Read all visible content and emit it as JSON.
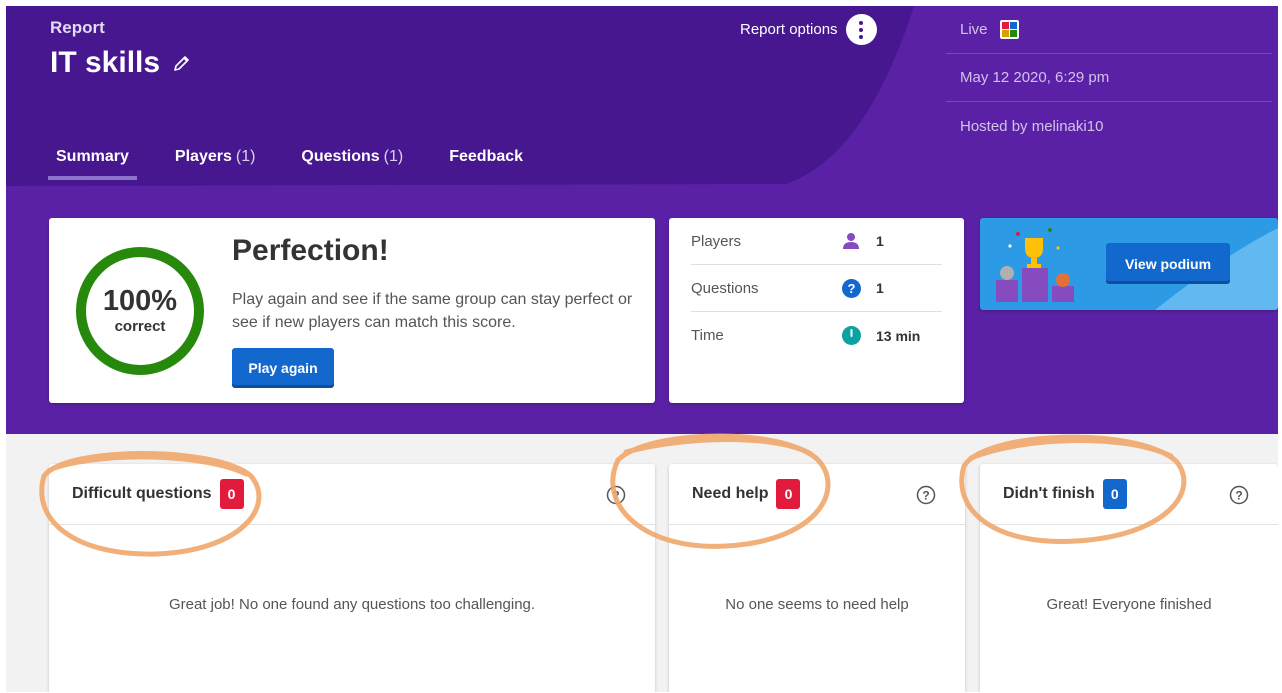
{
  "header": {
    "report_label": "Report",
    "title": "IT skills",
    "report_options_label": "Report options",
    "tabs": [
      {
        "label": "Summary",
        "count": ""
      },
      {
        "label": "Players",
        "count": "(1)"
      },
      {
        "label": "Questions",
        "count": "(1)"
      },
      {
        "label": "Feedback",
        "count": ""
      }
    ],
    "active_tab": "Summary"
  },
  "side_info": {
    "mode": "Live",
    "date": "May 12 2020, 6:29 pm",
    "host": "Hosted by melinaki10"
  },
  "summary": {
    "score_value": "100%",
    "score_caption": "correct",
    "title": "Perfection!",
    "text": "Play again and see if the same group can stay perfect or see if new players can match this score.",
    "play_again_label": "Play again"
  },
  "stats": [
    {
      "label": "Players",
      "icon": "person-icon",
      "value": "1"
    },
    {
      "label": "Questions",
      "icon": "question-icon",
      "value": "1"
    },
    {
      "label": "Time",
      "icon": "clock-icon",
      "value": "13 min"
    }
  ],
  "podium": {
    "button_label": "View podium"
  },
  "panels": [
    {
      "title": "Difficult questions",
      "count": "0",
      "message": "Great job! No one found any questions too challenging."
    },
    {
      "title": "Need help",
      "count": "0",
      "message": "No one seems to need help"
    },
    {
      "title": "Didn't finish",
      "count": "0",
      "message": "Great! Everyone finished"
    }
  ],
  "colors": {
    "header_purple": "#46178f",
    "header_light_purple": "#5a21a6",
    "accent_blue": "#1368ce",
    "badge_red": "#e21b3c",
    "score_green": "#26890c",
    "annotation_orange": "#f0a66a"
  }
}
